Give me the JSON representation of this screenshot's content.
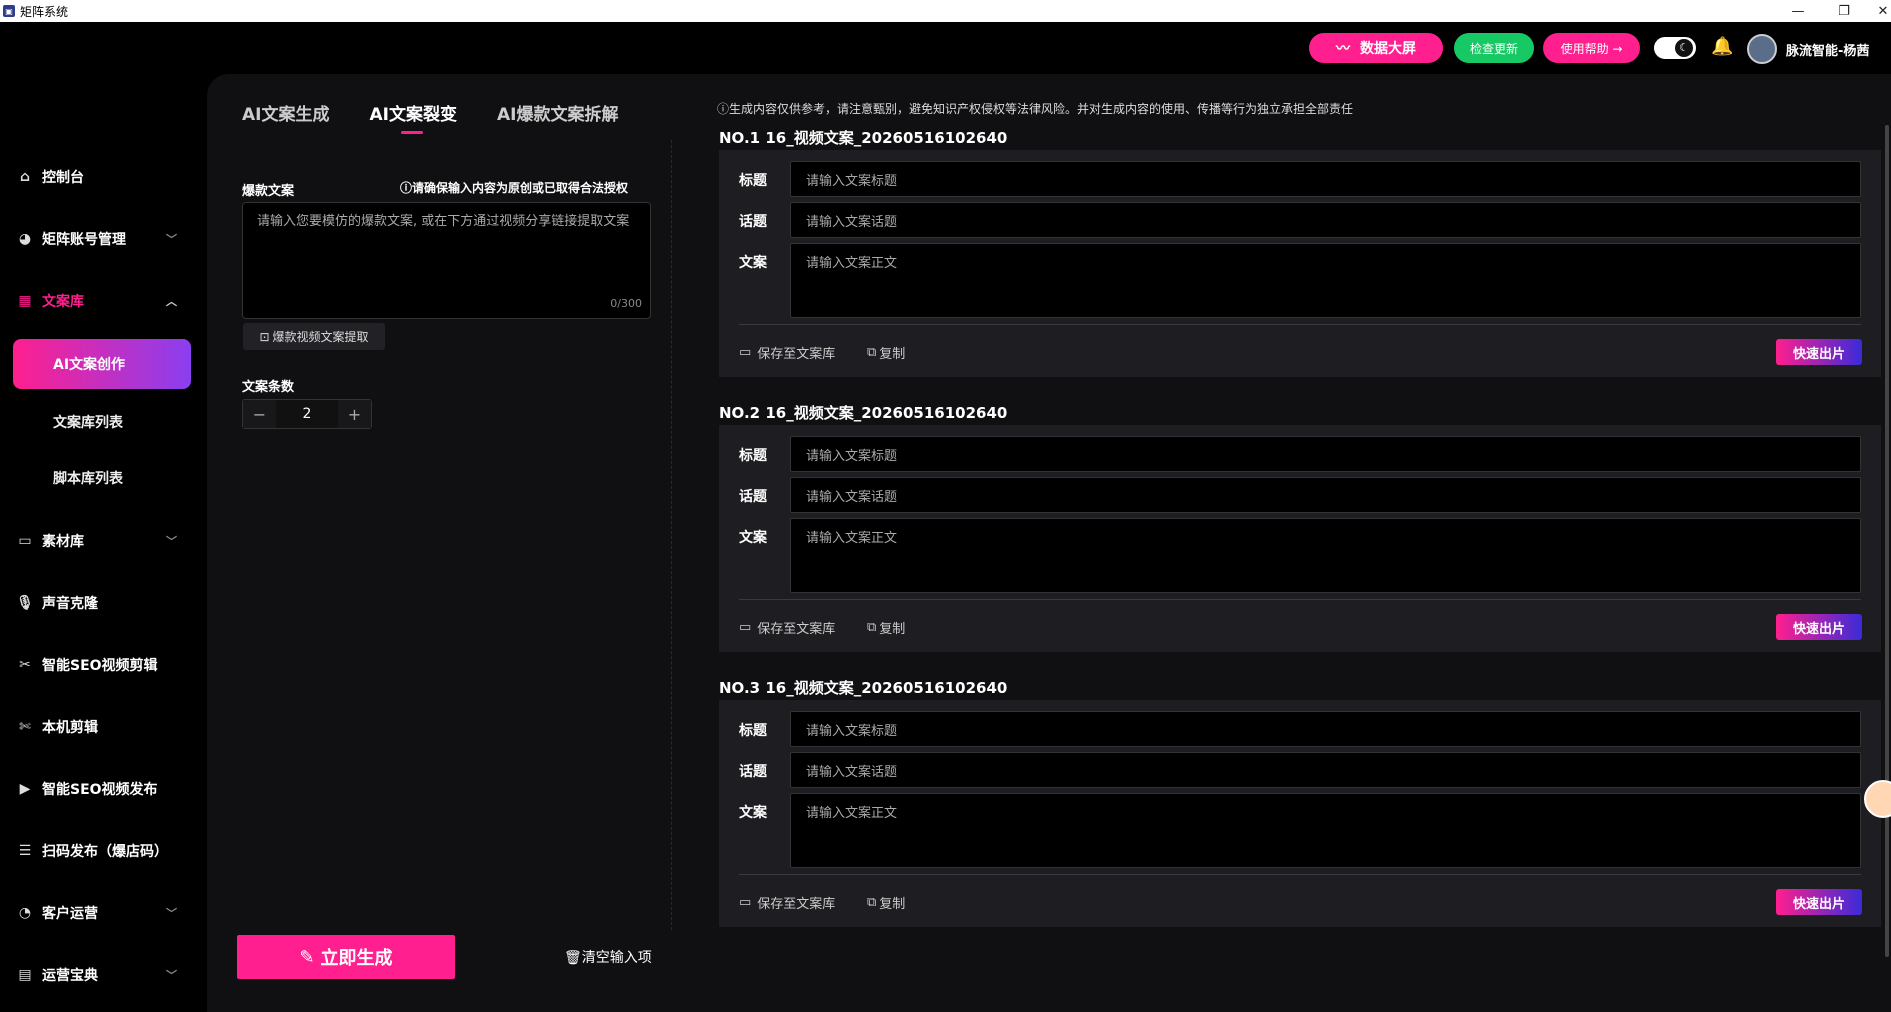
{
  "window": {
    "title": "矩阵系统"
  },
  "header": {
    "data_screen": "数据大屏",
    "check_update": "检查更新",
    "help": "使用帮助 →",
    "user_name": "脉流智能-杨茜"
  },
  "sidebar": {
    "items": [
      {
        "label": "控制台",
        "icon": "home-icon"
      },
      {
        "label": "矩阵账号管理",
        "icon": "account-icon"
      },
      {
        "label": "文案库",
        "icon": "library-icon"
      },
      {
        "label": "素材库",
        "icon": "folder-icon"
      },
      {
        "label": "声音克隆",
        "icon": "mic-icon"
      },
      {
        "label": "智能SEO视频剪辑",
        "icon": "scissors-icon"
      },
      {
        "label": "本机剪辑",
        "icon": "cut-icon"
      },
      {
        "label": "智能SEO视频发布",
        "icon": "video-icon"
      },
      {
        "label": "扫码发布（爆店码）",
        "icon": "qr-icon"
      },
      {
        "label": "客户运营",
        "icon": "customer-icon"
      },
      {
        "label": "运营宝典",
        "icon": "book-icon"
      }
    ],
    "sub_items": [
      "AI文案创作",
      "文案库列表",
      "脚本库列表"
    ]
  },
  "tabs": [
    "AI文案生成",
    "AI文案裂变",
    "AI爆款文案拆解"
  ],
  "left": {
    "hot_label": "爆款文案",
    "hot_hint": "请确保输入内容为原创或已取得合法授权",
    "hot_placeholder": "请输入您要模仿的爆款文案, 或在下方通过视频分享链接提取文案",
    "counter": "0/300",
    "extract_btn": "爆款视频文案提取",
    "count_label": "文案条数",
    "count_value": "2",
    "generate_btn": "立即生成",
    "clear_btn": "清空输入项"
  },
  "right": {
    "notice": "生成内容仅供参考，请注意甄别，避免知识产权侵权等法律风险。并对生成内容的使用、传播等行为独立承担全部责任",
    "cards": [
      {
        "title": "NO.1 16_视频文案_20260516102640"
      },
      {
        "title": "NO.2 16_视频文案_20260516102640"
      },
      {
        "title": "NO.3 16_视频文案_20260516102640"
      }
    ],
    "labels": {
      "title": "标题",
      "topic": "话题",
      "body": "文案"
    },
    "placeholders": {
      "title": "请输入文案标题",
      "topic": "请输入文案话题",
      "body": "请输入文案正文"
    },
    "save": "保存至文案库",
    "copy": "复制",
    "fast": "快速出片"
  }
}
